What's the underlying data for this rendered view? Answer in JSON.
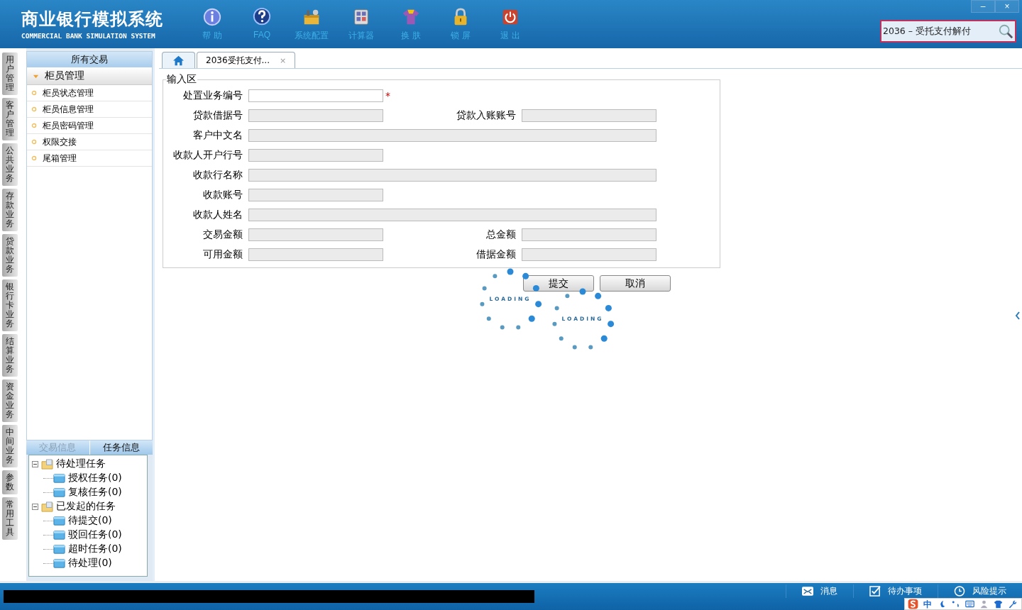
{
  "app": {
    "title": "商业银行模拟系统",
    "subtitle": "COMMERCIAL BANK SIMULATION SYSTEM"
  },
  "toolbar": [
    {
      "kind": "info",
      "label": "帮 助"
    },
    {
      "kind": "help",
      "label": "FAQ"
    },
    {
      "kind": "config",
      "label": "系统配置"
    },
    {
      "kind": "calc",
      "label": "计算器"
    },
    {
      "kind": "skin",
      "label": "换 肤"
    },
    {
      "kind": "lock",
      "label": "锁 屏"
    },
    {
      "kind": "exit",
      "label": "退 出"
    }
  ],
  "window_controls": [
    "–",
    "×"
  ],
  "search": {
    "value": "2036 – 受托支付解付"
  },
  "side_tabs": [
    "用户管理",
    "客户管理",
    "公共业务",
    "存款业务",
    "贷款业务",
    "银行卡业务",
    "结算业务",
    "资金业务",
    "中间业务",
    "参数",
    "常用工具"
  ],
  "sidebar": {
    "header": "所有交易",
    "group": {
      "label": "柜员管理",
      "expanded": true,
      "items": [
        "柜员状态管理",
        "柜员信息管理",
        "柜员密码管理",
        "权限交接",
        "尾箱管理"
      ]
    }
  },
  "info_tabs": [
    {
      "label": "交易信息",
      "selected": false
    },
    {
      "label": "任务信息",
      "selected": true
    }
  ],
  "task_tree": [
    {
      "label": "待处理任务",
      "expanded": true,
      "children": [
        {
          "label": "授权任务(0)"
        },
        {
          "label": "复核任务(0)"
        }
      ]
    },
    {
      "label": "已发起的任务",
      "expanded": true,
      "children": [
        {
          "label": "待提交(0)"
        },
        {
          "label": "驳回任务(0)"
        },
        {
          "label": "超时任务(0)"
        },
        {
          "label": "待处理(0)"
        }
      ]
    }
  ],
  "tabs": [
    {
      "kind": "home",
      "selected": false
    },
    {
      "kind": "page",
      "label": "2036受托支付...",
      "close": "×",
      "selected": true
    }
  ],
  "form": {
    "legend": "输入区",
    "rows": [
      [
        {
          "label": "处置业务编号",
          "kind": "half",
          "disabled": false,
          "required": true,
          "mark": "*"
        }
      ],
      [
        {
          "label": "贷款借据号",
          "kind": "half",
          "disabled": true,
          "required": false
        },
        {
          "label": "贷款入账账号",
          "kind": "half",
          "disabled": true,
          "required": false
        }
      ],
      [
        {
          "label": "客户中文名",
          "kind": "wide",
          "disabled": true,
          "required": false
        }
      ],
      [
        {
          "label": "收款人开户行号",
          "kind": "half",
          "disabled": true,
          "required": false
        }
      ],
      [
        {
          "label": "收款行名称",
          "kind": "wide",
          "disabled": true,
          "required": false
        }
      ],
      [
        {
          "label": "收款账号",
          "kind": "half",
          "disabled": true,
          "required": false
        }
      ],
      [
        {
          "label": "收款人姓名",
          "kind": "wide",
          "disabled": true,
          "required": false
        }
      ],
      [
        {
          "label": "交易金额",
          "kind": "half",
          "disabled": true,
          "required": false
        },
        {
          "label": "总金额",
          "kind": "half",
          "disabled": true,
          "required": false
        }
      ],
      [
        {
          "label": "可用金额",
          "kind": "half",
          "disabled": true,
          "required": false
        },
        {
          "label": "借据金额",
          "kind": "half",
          "disabled": true,
          "required": false
        }
      ]
    ],
    "buttons": [
      "提交",
      "取消"
    ]
  },
  "loaders": [
    "LOADING",
    "LOADING"
  ],
  "status_bar": [
    {
      "kind": "mail",
      "label": "消息"
    },
    {
      "kind": "check",
      "label": "待办事项"
    },
    {
      "kind": "clock",
      "label": "风险提示"
    }
  ],
  "ime": {
    "label": "中"
  }
}
